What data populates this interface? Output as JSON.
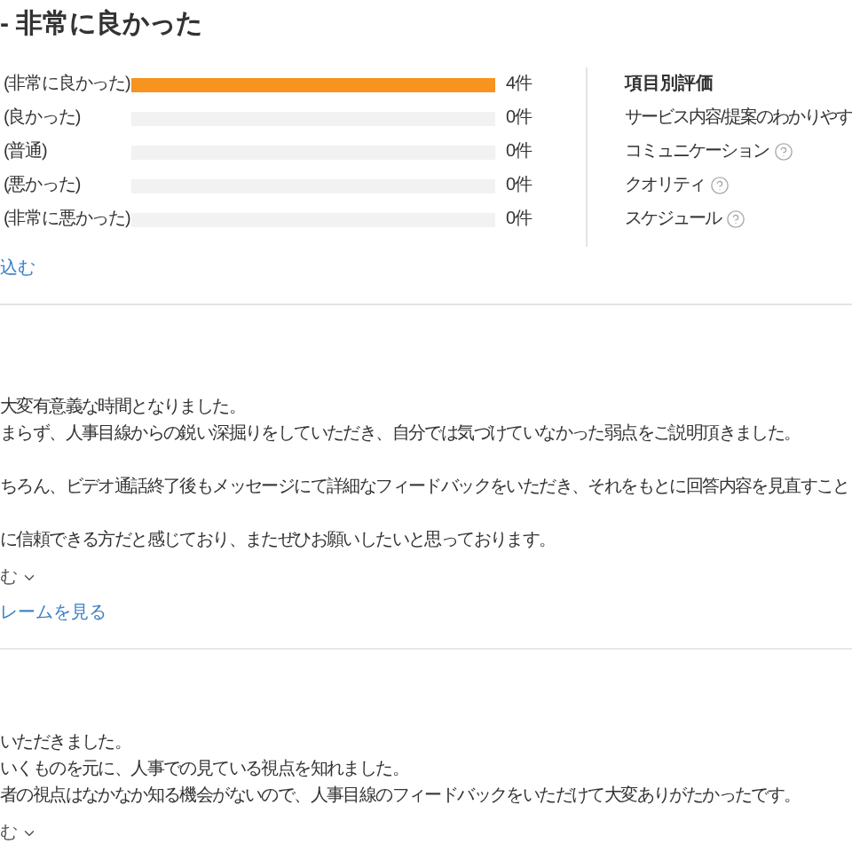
{
  "title": "- 非常に良かった",
  "ratings": [
    {
      "label": "(非常に良かった)",
      "level": 1,
      "count": "4件"
    },
    {
      "label": "(良かった)",
      "level": 0,
      "count": "0件"
    },
    {
      "label": "(普通)",
      "level": 0,
      "count": "0件"
    },
    {
      "label": "(悪かった)",
      "level": 0,
      "count": "0件"
    },
    {
      "label": "(非常に悪かった)",
      "level": 0,
      "count": "0件"
    }
  ],
  "item_ratings": {
    "heading": "項目別評価",
    "items": [
      {
        "label": "サービス内容/提案のわかりやす"
      },
      {
        "label": "コミュニケーション",
        "help": true
      },
      {
        "label": "クオリティ",
        "help": true
      },
      {
        "label": "スケジュール",
        "help": true
      }
    ]
  },
  "filter_link": "込む",
  "reviews": [
    {
      "paragraphs": [
        [
          "大変有意義な時間となりました。",
          "まらず、人事目線からの鋭い深掘りをしていただき、自分では気づけていなかった弱点をご説明頂きました。"
        ],
        [
          "ちろん、ビデオ通話終了後もメッセージにて詳細なフィードバックをいただき、それをもとに回答内容を見直すこと"
        ],
        [
          "に信頼できる方だと感じており、またぜひお願いしたいと思っております。"
        ]
      ],
      "more": "む",
      "link": "レームを見る"
    },
    {
      "paragraphs": [
        [
          "いただきました。",
          "いくものを元に、人事での見ている視点を知れました。",
          "者の視点はなかなか知る機会がないので、人事目線のフィードバックをいただけて大変ありがたかったです。"
        ]
      ],
      "more": "む"
    }
  ]
}
